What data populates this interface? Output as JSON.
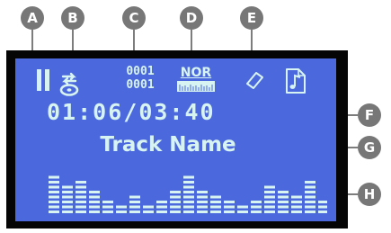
{
  "callouts": [
    "A",
    "B",
    "C",
    "D",
    "E",
    "F",
    "G",
    "H"
  ],
  "status": {
    "counter_top": "0001",
    "counter_bottom": "0001",
    "eq_mode": "NOR",
    "pause_icon": "pause-icon",
    "repeat_icon": "repeat-icon",
    "tag_icon": "tag-icon",
    "note_icon": "music-note-file-icon"
  },
  "time": {
    "elapsed": "01:06",
    "total": "03:40"
  },
  "track_name": "Track Name",
  "spectrum": {
    "levels": [
      8,
      6,
      7,
      5,
      3,
      2,
      4,
      2,
      3,
      5,
      8,
      5,
      4,
      3,
      2,
      3,
      6,
      5,
      4,
      7,
      3,
      2
    ]
  },
  "colors": {
    "lcd_background": "#4c68dd",
    "lcd_foreground": "#d7f4f2",
    "bezel": "#050505",
    "callout": "#777777"
  }
}
